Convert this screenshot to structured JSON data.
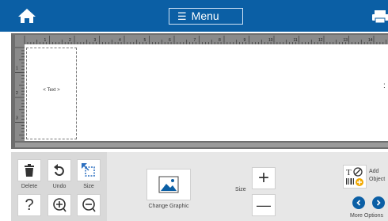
{
  "topbar": {
    "home_icon": "home-icon",
    "menu_icon": "hamburger-icon",
    "menu_label": "Menu",
    "printer_icon": "printer-icon"
  },
  "editor": {
    "ruler_top_numbers": [
      "1",
      "2",
      "3",
      "4",
      "5",
      "6",
      "7",
      "8",
      "9",
      "10",
      "11",
      "12",
      "13",
      "14"
    ],
    "ruler_left_numbers": [
      "1",
      "2",
      "3",
      "4"
    ],
    "label_text": "< Text >"
  },
  "toolbar": {
    "delete_label": "Delete",
    "undo_label": "Undo",
    "size_tool_label": "Size",
    "help_icon": "question-icon",
    "zoom_in_icon": "zoom-in-icon",
    "zoom_out_icon": "zoom-out-icon"
  },
  "properties": {
    "change_graphic_label": "Change Graphic",
    "size_label": "Size",
    "increase_symbol": "+",
    "decrease_symbol": "—",
    "add_object_label": "Add Object",
    "more_options_label": "More Options"
  },
  "colors": {
    "topbar": "#0b5fa5",
    "editor_bg": "#6e6e6e",
    "panel_bg": "#e7e7e7"
  }
}
